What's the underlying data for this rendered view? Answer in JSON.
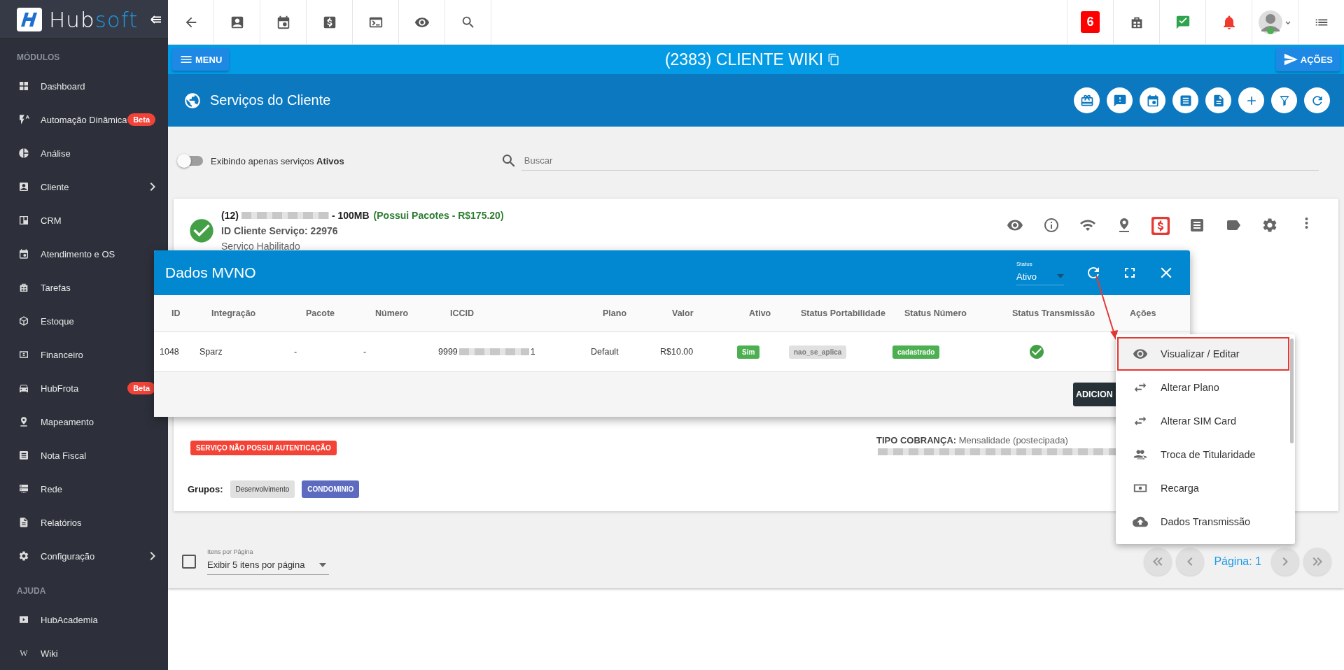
{
  "sidebar": {
    "logo": {
      "text_a": "Hub",
      "text_b": "soft"
    },
    "sections": [
      {
        "title": "MÓDULOS",
        "items": [
          {
            "label": "Dashboard",
            "chevron": false
          },
          {
            "label": "Automação Dinâmica",
            "badge": "Beta",
            "chevron": false
          },
          {
            "label": "Análise",
            "chevron": false
          },
          {
            "label": "Cliente",
            "chevron": true
          },
          {
            "label": "CRM",
            "chevron": false
          },
          {
            "label": "Atendimento e OS",
            "chevron": false
          },
          {
            "label": "Tarefas",
            "chevron": false
          },
          {
            "label": "Estoque",
            "chevron": false
          },
          {
            "label": "Financeiro",
            "chevron": false
          },
          {
            "label": "HubFrota",
            "badge": "Beta",
            "chevron": false
          },
          {
            "label": "Mapeamento",
            "chevron": false
          },
          {
            "label": "Nota Fiscal",
            "chevron": false
          },
          {
            "label": "Rede",
            "chevron": false
          },
          {
            "label": "Relatórios",
            "chevron": false
          },
          {
            "label": "Configuração",
            "chevron": true
          }
        ]
      },
      {
        "title": "AJUDA",
        "items": [
          {
            "label": "HubAcademia",
            "chevron": false
          },
          {
            "label": "Wiki",
            "glyph": "W",
            "chevron": false
          }
        ]
      }
    ]
  },
  "topbar": {
    "notification_count": "6"
  },
  "header": {
    "menu_button": "MENU",
    "title": "(2383) CLIENTE WIKI",
    "actions_button": "AÇÕES"
  },
  "section": {
    "title": "Serviços do Cliente"
  },
  "filters": {
    "toggle_label": "Exibindo apenas serviços **Ativos**",
    "toggle_on": false,
    "search": {
      "placeholder": "Buscar"
    }
  },
  "service": {
    "line1_prefix": "(12)",
    "line1_suffix": "- 100MB",
    "package": "(Possui Pacotes - R$175.20)",
    "id_line": "ID Cliente Serviço: 22976",
    "status": "Serviço Habilitado",
    "auth_badge": "SERVIÇO NÃO POSSUI AUTENTICAÇÃO",
    "billing_label": "TIPO COBRANÇA:",
    "billing_value": "Mensalidade (postecipada)",
    "groups_label": "Grupos:",
    "groups": [
      {
        "label": "Desenvolvimento",
        "color": "#e0e0e0"
      },
      {
        "label": "CONDOMINIO",
        "color": "#5c6bc0"
      }
    ]
  },
  "modal": {
    "title": "Dados MVNO",
    "status_label": "Status",
    "status_value": "Ativo",
    "columns": [
      "ID",
      "Integração",
      "Pacote",
      "Número",
      "ICCID",
      "Plano",
      "Valor",
      "Ativo",
      "Status Portabilidade",
      "Status Número",
      "Status Transmissão",
      "Ações"
    ],
    "rows": [
      {
        "cells": [
          {
            "kind": "text",
            "text": "1048"
          },
          {
            "kind": "text",
            "text": "Sparz"
          },
          {
            "kind": "text",
            "text": "-"
          },
          {
            "kind": "text",
            "text": "-"
          },
          {
            "kind": "redacted",
            "text": "9999",
            "tail": "1"
          },
          {
            "kind": "text",
            "text": "Default"
          },
          {
            "kind": "text",
            "text": "R$10.00"
          },
          {
            "kind": "badge",
            "text": "Sim",
            "color": "#4caf50"
          },
          {
            "kind": "badge",
            "text": "nao_se_aplica",
            "color": "#e0e0e0"
          },
          {
            "kind": "badge",
            "text": "cadastrado",
            "color": "#4caf50"
          },
          {
            "kind": "check"
          }
        ]
      }
    ],
    "add_button": "ADICION"
  },
  "action_menu": [
    {
      "label": "Visualizar / Editar",
      "selected": true
    },
    {
      "label": "Alterar Plano",
      "selected": false
    },
    {
      "label": "Alterar SIM Card",
      "selected": false
    },
    {
      "label": "Troca de Titularidade",
      "selected": false
    },
    {
      "label": "Recarga",
      "selected": false
    },
    {
      "label": "Dados Transmissão",
      "selected": false
    }
  ],
  "pager": {
    "checked": false,
    "per_page_label": "Itens por Página",
    "per_page_value": "Exibir 5 itens por página",
    "page": "Página: 1"
  }
}
